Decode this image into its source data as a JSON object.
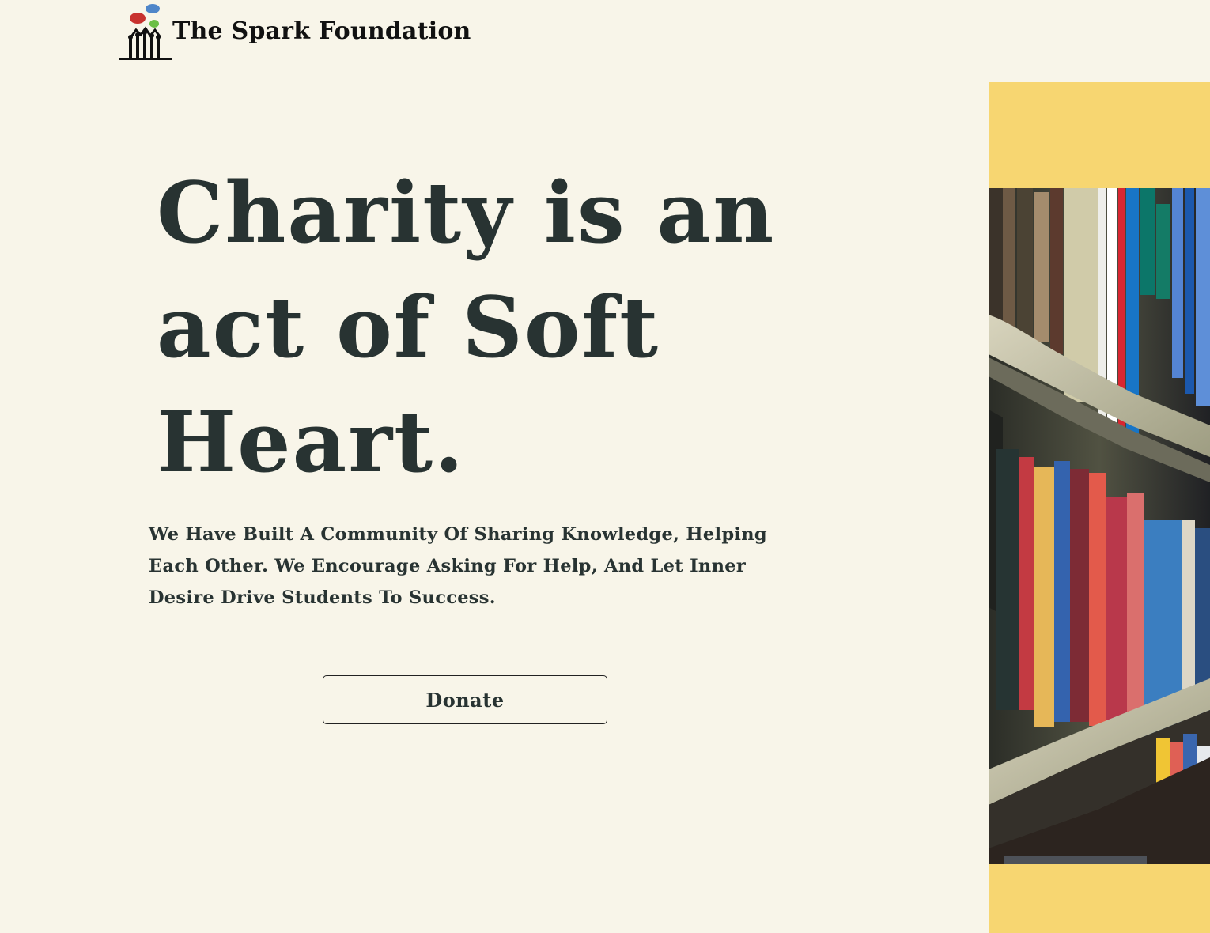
{
  "header": {
    "brand_name": "The Spark Foundation",
    "logo_icon": "foundation-logo-icon"
  },
  "hero": {
    "title": "Charity is an act of Soft Heart.",
    "subtitle": "We Have Built A Community Of Sharing Knowledge, Helping Each Other. We Encourage Asking For Help, And Let Inner Desire Drive Students To Success.",
    "donate_label": "Donate"
  },
  "image": {
    "description": "library-bookshelf-image"
  },
  "colors": {
    "background": "#f8f5e9",
    "text": "#283332",
    "accent_panel": "#f7d671",
    "button_border": "#222222"
  }
}
